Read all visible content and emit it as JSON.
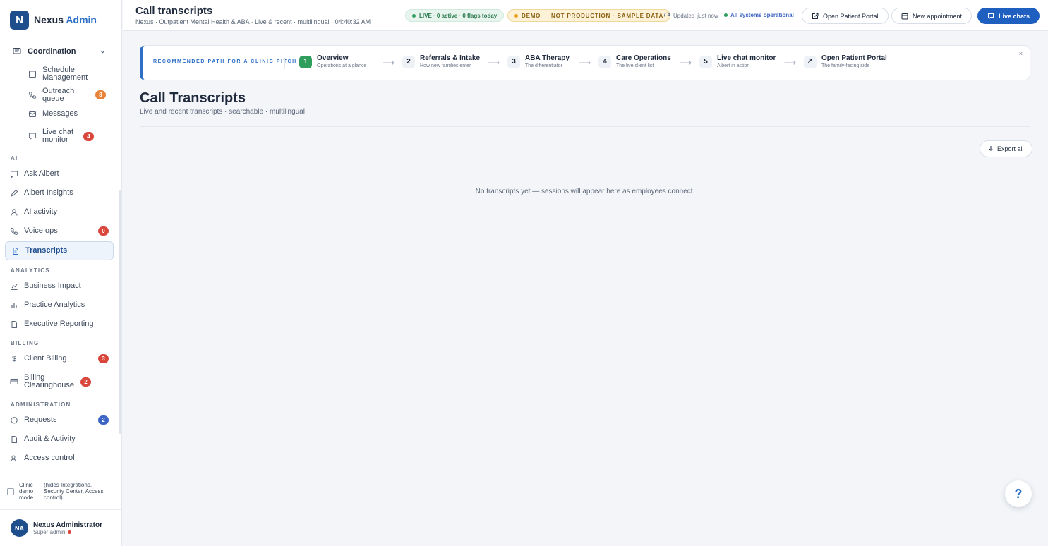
{
  "brand": {
    "logo": "N",
    "name": "Nexus",
    "suffix": "Admin"
  },
  "sidebar": {
    "coordination": {
      "label": "Coordination",
      "items": [
        {
          "label": "Schedule Management",
          "icon": "calendar-icon"
        },
        {
          "label": "Outreach queue",
          "badge": "8",
          "icon": "phone-icon"
        },
        {
          "label": "Messages",
          "icon": "mail-icon"
        },
        {
          "label": "Live chat monitor",
          "badge": "4",
          "icon": "chat-icon"
        }
      ]
    },
    "ai": {
      "label": "AI",
      "items": [
        {
          "label": "Ask Albert"
        },
        {
          "label": "Albert Insights"
        },
        {
          "label": "AI activity"
        },
        {
          "label": "Voice ops",
          "badge": "0"
        },
        {
          "label": "Transcripts"
        }
      ]
    },
    "analytics": {
      "label": "ANALYTICS",
      "items": [
        {
          "label": "Business Impact"
        },
        {
          "label": "Practice Analytics"
        },
        {
          "label": "Executive Reporting"
        }
      ]
    },
    "billing": {
      "label": "BILLING",
      "items": [
        {
          "label": "Client Billing",
          "badge": "3"
        },
        {
          "label": "Billing Clearinghouse",
          "badge": "2"
        }
      ]
    },
    "administration": {
      "label": "ADMINISTRATION",
      "items": [
        {
          "label": "Requests",
          "badge": "2"
        },
        {
          "label": "Audit & Activity"
        },
        {
          "label": "Access control"
        }
      ]
    },
    "demo_mode": {
      "label": "Clinic demo mode",
      "note": "(hides Integrations, Security Center, Access control)"
    },
    "user": {
      "initials": "NA",
      "name": "Nexus Administrator",
      "role": "Super admin"
    }
  },
  "topbar": {
    "title": "Call transcripts",
    "subtitle": "Nexus · Outpatient Mental Health & ABA · Live & recent · multilingual · 04:40:32 AM",
    "live_pill": "LIVE · 0 active · 0 flags today",
    "demo_pill": "DEMO — NOT PRODUCTION · SAMPLE DATA",
    "updated": "Updated",
    "updated_when": "just now",
    "status": "All systems operational",
    "open_portal": "Open Patient Portal",
    "new_appointment": "New appointment",
    "live_chats": "Live chats"
  },
  "pitch": {
    "label": "RECOMMENDED PATH FOR A CLINIC PITCH",
    "close": "×",
    "steps": [
      {
        "num": "1",
        "title": "Overview",
        "desc": "Operations at a glance"
      },
      {
        "num": "2",
        "title": "Referrals & Intake",
        "desc": "How new families enter"
      },
      {
        "num": "3",
        "title": "ABA Therapy",
        "desc": "The differentiator"
      },
      {
        "num": "4",
        "title": "Care Operations",
        "desc": "The live client list"
      },
      {
        "num": "5",
        "title": "Live chat monitor",
        "desc": "Albert in action"
      },
      {
        "num": "↗",
        "title": "Open Patient Portal",
        "desc": "The family-facing side"
      }
    ]
  },
  "page": {
    "title": "Call Transcripts",
    "subtitle": "Live and recent transcripts · searchable · multilingual",
    "export": "Export all",
    "empty": "No transcripts yet — sessions will appear here as employees connect."
  },
  "help": "?",
  "colors": {
    "accent": "#2d6fc7",
    "primary_button": "#1f5fbf",
    "live": "#2f9e5c",
    "demo": "#e8a21f"
  }
}
